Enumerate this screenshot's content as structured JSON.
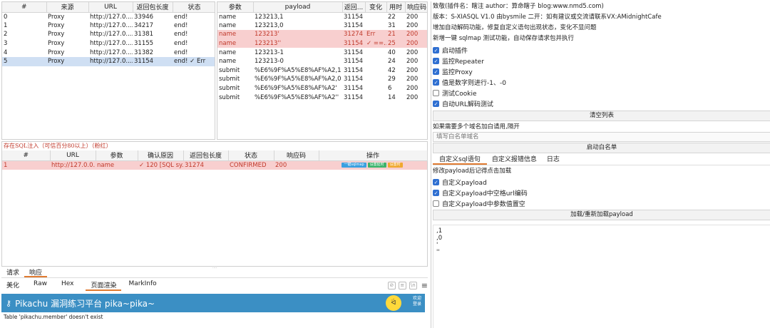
{
  "proxy_table": {
    "headers": [
      "#",
      "来源",
      "URL",
      "返回包长度",
      "状态"
    ],
    "rows": [
      [
        "0",
        "Proxy",
        "http://127.0....",
        "33946",
        "end!"
      ],
      [
        "1",
        "Proxy",
        "http://127.0....",
        "34217",
        "end!"
      ],
      [
        "2",
        "Proxy",
        "http://127.0....",
        "31381",
        "end!"
      ],
      [
        "3",
        "Proxy",
        "http://127.0....",
        "31155",
        "end!"
      ],
      [
        "4",
        "Proxy",
        "http://127.0....",
        "31382",
        "end!"
      ],
      [
        "5",
        "Proxy",
        "http://127.0....",
        "31154",
        "end! ✓ Err"
      ]
    ],
    "selected_row": 5
  },
  "payload_table": {
    "headers": [
      "参数",
      "payload",
      "返回...",
      "变化",
      "用时",
      "响应码"
    ],
    "rows": [
      [
        "name",
        "123213,1",
        "31154",
        "",
        "22",
        "200"
      ],
      [
        "name",
        "123213,0",
        "31154",
        "",
        "31",
        "200"
      ],
      [
        "name",
        "123213'",
        "31274",
        "Err",
        "21",
        "200"
      ],
      [
        "name",
        "123213''",
        "31154",
        "✓ ==...",
        "25",
        "200"
      ],
      [
        "name",
        "123213-1",
        "31154",
        "",
        "40",
        "200"
      ],
      [
        "name",
        "123213-0",
        "31154",
        "",
        "24",
        "200"
      ],
      [
        "submit",
        "%E6%9F%A5%E8%AF%A2,1",
        "31154",
        "",
        "42",
        "200"
      ],
      [
        "submit",
        "%E6%9F%A5%E8%AF%A2,0",
        "31154",
        "",
        "29",
        "200"
      ],
      [
        "submit",
        "%E6%9F%A5%E8%AF%A2'",
        "31154",
        "",
        "6",
        "200"
      ],
      [
        "submit",
        "%E6%9F%A5%E8%AF%A2''",
        "31154",
        "",
        "14",
        "200"
      ]
    ],
    "highlighted_rows": [
      2,
      3
    ]
  },
  "injection": {
    "title": "存在SQL注入（可信百分80以上）（粉红）",
    "headers": [
      "#",
      "URL",
      "参数",
      "确认原因",
      "返回包长度",
      "状态",
      "响应码",
      "操作"
    ],
    "rows": [
      [
        "1",
        "http://127.0.0....",
        "name",
        "✓ 120 [SQL sy...",
        "31274",
        "CONFIRMED",
        "200"
      ]
    ],
    "actions": [
      "一键sqlmap",
      "设置延时",
      "设置时"
    ]
  },
  "info": {
    "line1": "致敬(插件名：瞎注 author：算命瞎子 blog:www.nmd5.com)",
    "line2": "版本：S-XIASQL V1.0 由bysmile 二开：如有建议或交流请联系VX:AMidnightCafe",
    "line3": "增加自动解码功能，修复自定义语句出现状态，变化不显问题",
    "line4": "新增一键 sqlmap 测试功能，自动保存请求包并执行"
  },
  "settings": [
    {
      "label": "启动插件",
      "checked": true
    },
    {
      "label": "监控Repeater",
      "checked": true
    },
    {
      "label": "监控Proxy",
      "checked": true
    },
    {
      "label": "值是数字则进行-1、-0",
      "checked": true
    },
    {
      "label": "测试Cookie",
      "checked": false
    },
    {
      "label": "自动URL解码测试",
      "checked": true
    }
  ],
  "clear_button": "清空列表",
  "whitelist_hint": "如果需要多个域名加白请用,隔开",
  "whitelist_placeholder": "填写白名单域名",
  "whitelist_button": "启动白名单",
  "right_tabs": [
    "自定义sql语句",
    "自定义报错信息",
    "日志"
  ],
  "custom_hint": "修改payload后记得点击加载",
  "custom_settings": [
    {
      "label": "自定义payload",
      "checked": true
    },
    {
      "label": "自定义payload中空格url编码",
      "checked": true
    },
    {
      "label": "自定义payload中参数值置空",
      "checked": false
    }
  ],
  "load_button": "加载/重新加载payload",
  "payload_editor": [
    ",1",
    ",0",
    "'",
    "''"
  ],
  "bottom_tabs": [
    "请求",
    "响应"
  ],
  "view_tabs": [
    "美化",
    "Raw",
    "Hex",
    "页面渲染",
    "MarkInfo"
  ],
  "pikachu": {
    "title": "Pikachu 漏洞练习平台 pika~pika~",
    "welcome": "欢迎",
    "welcome2": "登录",
    "error": "Table 'pikachu.member' doesn't exist"
  },
  "colors": {
    "selection": "#cfdff3",
    "highlight": "#f8cfcf",
    "pikachu_banner": "#3b8fc4",
    "accent_tab": "#e07a30"
  }
}
